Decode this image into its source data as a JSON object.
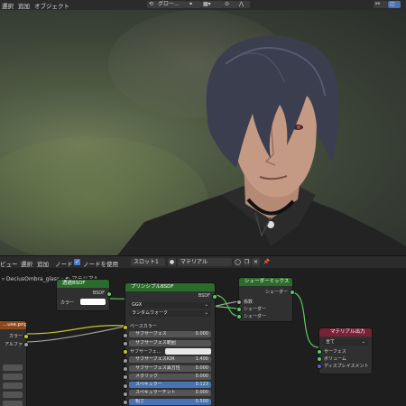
{
  "topbar": {
    "menu": [
      "選択",
      "追加",
      "オブジェクト"
    ],
    "transform_dropdown": "グロー...",
    "right_icons": [
      "link-icon",
      "overlay-icon"
    ]
  },
  "viewport": {
    "description_visible": ""
  },
  "node_header": {
    "menu": [
      "ビュー",
      "選択",
      "追加",
      "ノード"
    ],
    "use_nodes_label": "ノードを使用",
    "slot_label": "スロット1",
    "material_name": "マテリアル"
  },
  "breadcrumb": {
    "object": "DeciusOmbra_glass",
    "material": "マテリアル"
  },
  "nodes": {
    "transparent": {
      "title": "透過BSDF",
      "output": "BSDF",
      "input_color": "カラー"
    },
    "principled": {
      "title": "プリンシプルBSDF",
      "output": "BSDF",
      "distribution": "GGX",
      "subsurface_method": "ランダムウォーク",
      "rows": [
        {
          "label": "ベースカラー",
          "value": "",
          "kind": "socket"
        },
        {
          "label": "サブサーフェス",
          "value": "0.000",
          "kind": "field"
        },
        {
          "label": "サブサーフェス範囲",
          "value": "",
          "kind": "field"
        },
        {
          "label": "サブサーフェ...",
          "value": "",
          "kind": "color"
        },
        {
          "label": "サブサーフェスIOR",
          "value": "1.400",
          "kind": "field"
        },
        {
          "label": "サブサーフェス異方性",
          "value": "0.000",
          "kind": "field"
        },
        {
          "label": "メタリック",
          "value": "0.000",
          "kind": "field"
        },
        {
          "label": "スペキュラー",
          "value": "0.123",
          "kind": "blue"
        },
        {
          "label": "スペキュラーチント",
          "value": "0.000",
          "kind": "field"
        },
        {
          "label": "粗さ",
          "value": "0.500",
          "kind": "blue"
        }
      ]
    },
    "mix_shader": {
      "title": "シェーダーミックス",
      "output": "シェーダー",
      "inputs": [
        "係数",
        "シェーダー",
        "シェーダー"
      ]
    },
    "material_output": {
      "title": "マテリアル出力",
      "target": "全て",
      "inputs": [
        "サーフェス",
        "ボリューム",
        "ディスプレイスメント"
      ]
    },
    "image_texture": {
      "title": "...use.png",
      "outputs": [
        "カラー",
        "アルファ"
      ]
    }
  },
  "colors": {
    "shader_header": "#2b6b2b",
    "output_header": "#7a2235",
    "texture_header": "#8a4a1c",
    "accent_blue": "#4772b3"
  }
}
